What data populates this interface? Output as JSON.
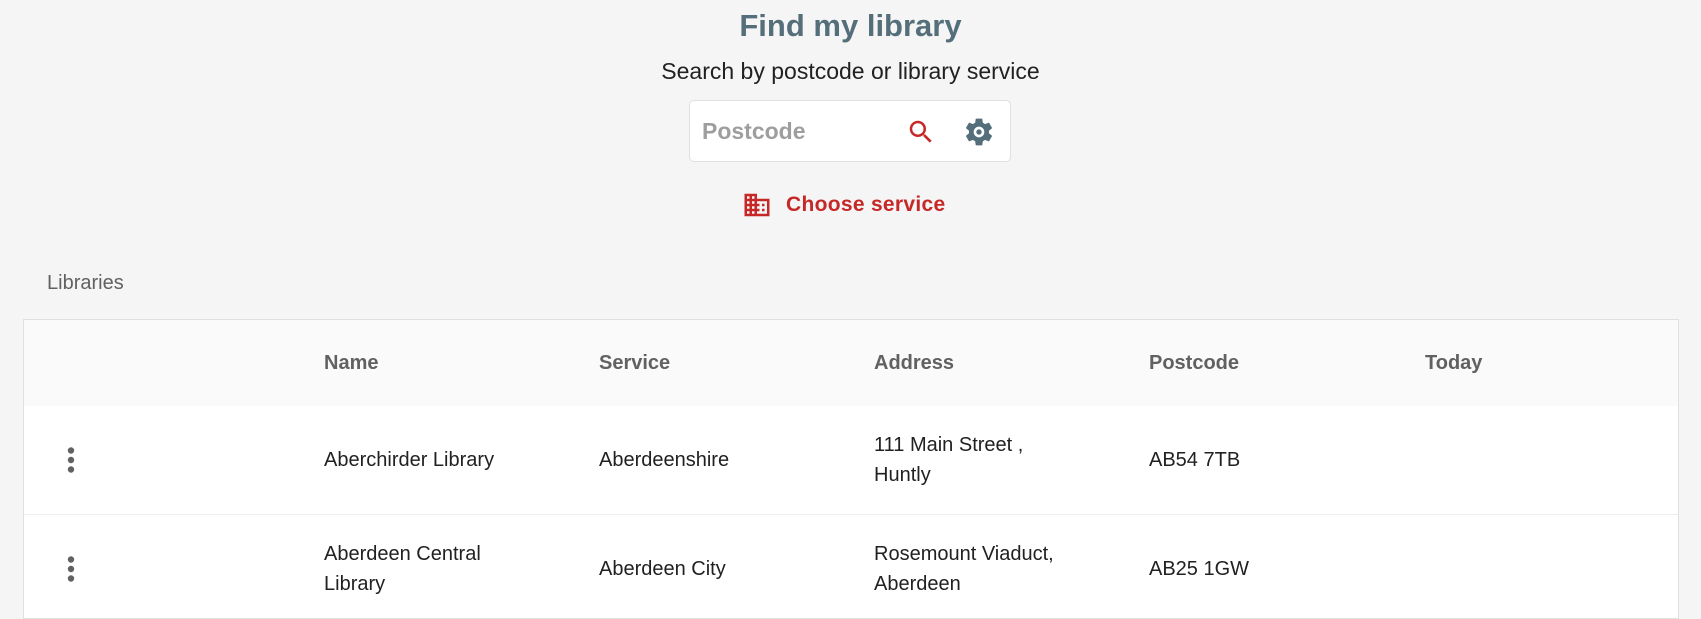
{
  "header": {
    "title": "Find my library",
    "subtitle": "Search by postcode or library service"
  },
  "search": {
    "placeholder": "Postcode",
    "value": "",
    "search_icon": "search-icon",
    "settings_icon": "gear-icon"
  },
  "choose_service": {
    "label": "Choose service",
    "icon": "building-icon"
  },
  "libraries": {
    "section_label": "Libraries",
    "columns": [
      "",
      "Name",
      "Service",
      "Address",
      "Postcode",
      "Today"
    ],
    "rows": [
      {
        "name": "Aberchirder Library",
        "service": "Aberdeenshire",
        "address": "111 Main Street , Huntly",
        "postcode": "AB54 7TB",
        "today": ""
      },
      {
        "name": "Aberdeen Central Library",
        "service": "Aberdeen City",
        "address": "Rosemount Viaduct, Aberdeen",
        "postcode": "AB25 1GW",
        "today": ""
      }
    ]
  },
  "colors": {
    "title": "#546e7a",
    "accent": "#c62828",
    "settings": "#546e7a",
    "background": "#f5f5f5"
  }
}
